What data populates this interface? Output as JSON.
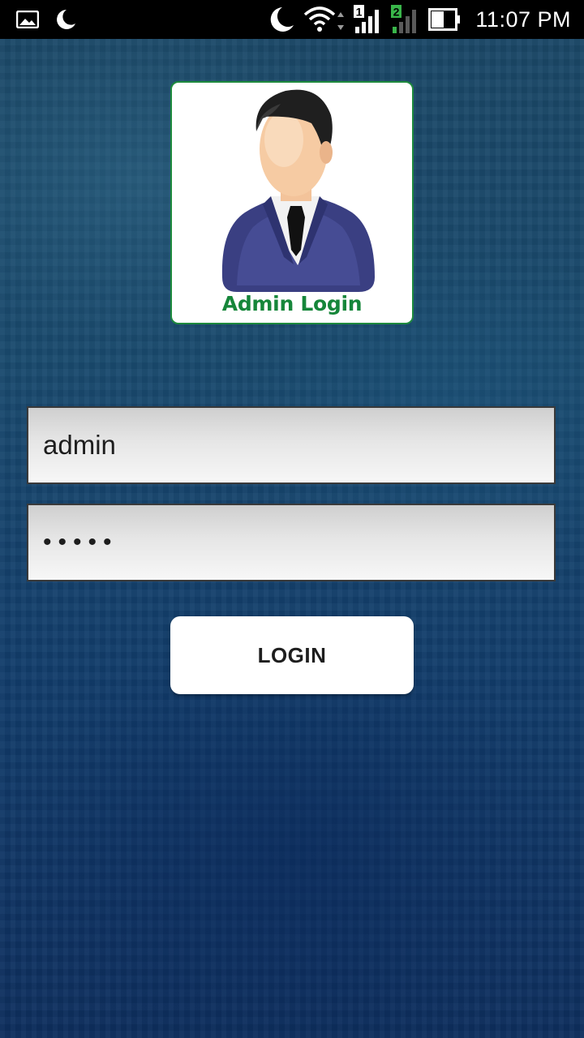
{
  "status_bar": {
    "time": "11:07 PM",
    "left_icons": [
      "gallery-icon",
      "moon-icon"
    ],
    "right_icons": [
      "moon-icon",
      "wifi-icon",
      "signal-sim1-icon",
      "signal-sim2-icon",
      "battery-icon"
    ],
    "sim1_label": "1",
    "sim2_label": "2"
  },
  "logo": {
    "caption": "Admin Login",
    "border_color": "#1e8a3e",
    "caption_color": "#16863a"
  },
  "form": {
    "username_value": "admin",
    "password_value": "•••••",
    "login_label": "LOGIN"
  },
  "colors": {
    "background": "#14385c",
    "status_bar": "#000000",
    "button_bg": "#ffffff"
  }
}
